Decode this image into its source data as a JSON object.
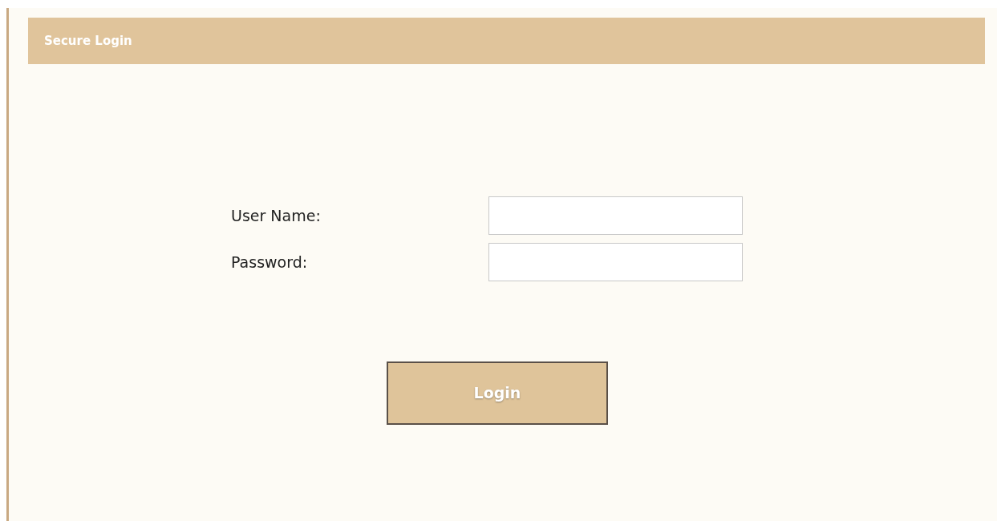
{
  "header": {
    "title": "Secure Login"
  },
  "fields": [
    {
      "label": "User Name:"
    },
    {
      "label": "Password:"
    }
  ],
  "button": {
    "label": "Login"
  }
}
